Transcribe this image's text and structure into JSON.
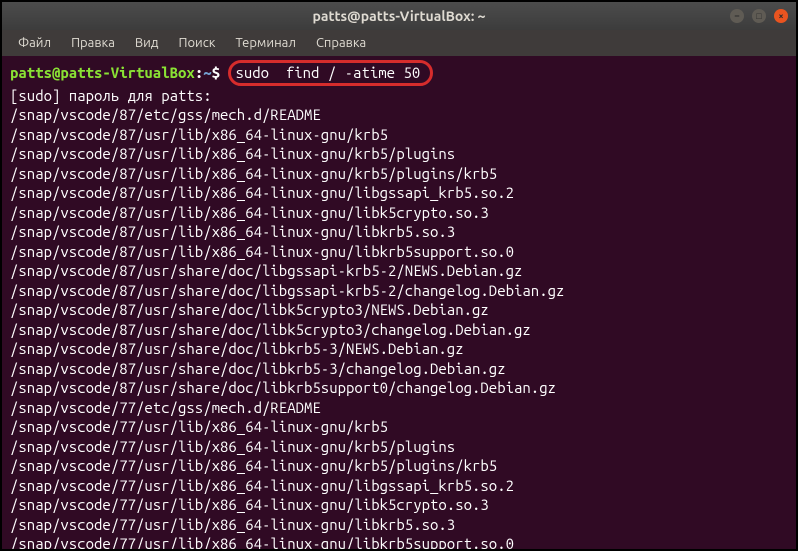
{
  "titlebar": {
    "title": "patts@patts-VirtualBox: ~"
  },
  "menubar": {
    "items": [
      "Файл",
      "Правка",
      "Вид",
      "Поиск",
      "Терминал",
      "Справка"
    ]
  },
  "prompt": {
    "user_host": "patts@patts-VirtualBox",
    "colon": ":",
    "path": "~",
    "dollar": "$"
  },
  "command": "sudo  find / -atime 50",
  "output": [
    "[sudo] пароль для patts:",
    "/snap/vscode/87/etc/gss/mech.d/README",
    "/snap/vscode/87/usr/lib/x86_64-linux-gnu/krb5",
    "/snap/vscode/87/usr/lib/x86_64-linux-gnu/krb5/plugins",
    "/snap/vscode/87/usr/lib/x86_64-linux-gnu/krb5/plugins/krb5",
    "/snap/vscode/87/usr/lib/x86_64-linux-gnu/libgssapi_krb5.so.2",
    "/snap/vscode/87/usr/lib/x86_64-linux-gnu/libk5crypto.so.3",
    "/snap/vscode/87/usr/lib/x86_64-linux-gnu/libkrb5.so.3",
    "/snap/vscode/87/usr/lib/x86_64-linux-gnu/libkrb5support.so.0",
    "/snap/vscode/87/usr/share/doc/libgssapi-krb5-2/NEWS.Debian.gz",
    "/snap/vscode/87/usr/share/doc/libgssapi-krb5-2/changelog.Debian.gz",
    "/snap/vscode/87/usr/share/doc/libk5crypto3/NEWS.Debian.gz",
    "/snap/vscode/87/usr/share/doc/libk5crypto3/changelog.Debian.gz",
    "/snap/vscode/87/usr/share/doc/libkrb5-3/NEWS.Debian.gz",
    "/snap/vscode/87/usr/share/doc/libkrb5-3/changelog.Debian.gz",
    "/snap/vscode/87/usr/share/doc/libkrb5support0/changelog.Debian.gz",
    "/snap/vscode/77/etc/gss/mech.d/README",
    "/snap/vscode/77/usr/lib/x86_64-linux-gnu/krb5",
    "/snap/vscode/77/usr/lib/x86_64-linux-gnu/krb5/plugins",
    "/snap/vscode/77/usr/lib/x86_64-linux-gnu/krb5/plugins/krb5",
    "/snap/vscode/77/usr/lib/x86_64-linux-gnu/libgssapi_krb5.so.2",
    "/snap/vscode/77/usr/lib/x86_64-linux-gnu/libk5crypto.so.3",
    "/snap/vscode/77/usr/lib/x86_64-linux-gnu/libkrb5.so.3",
    "/snap/vscode/77/usr/lib/x86_64-linux-gnu/libkrb5support.so.0"
  ]
}
